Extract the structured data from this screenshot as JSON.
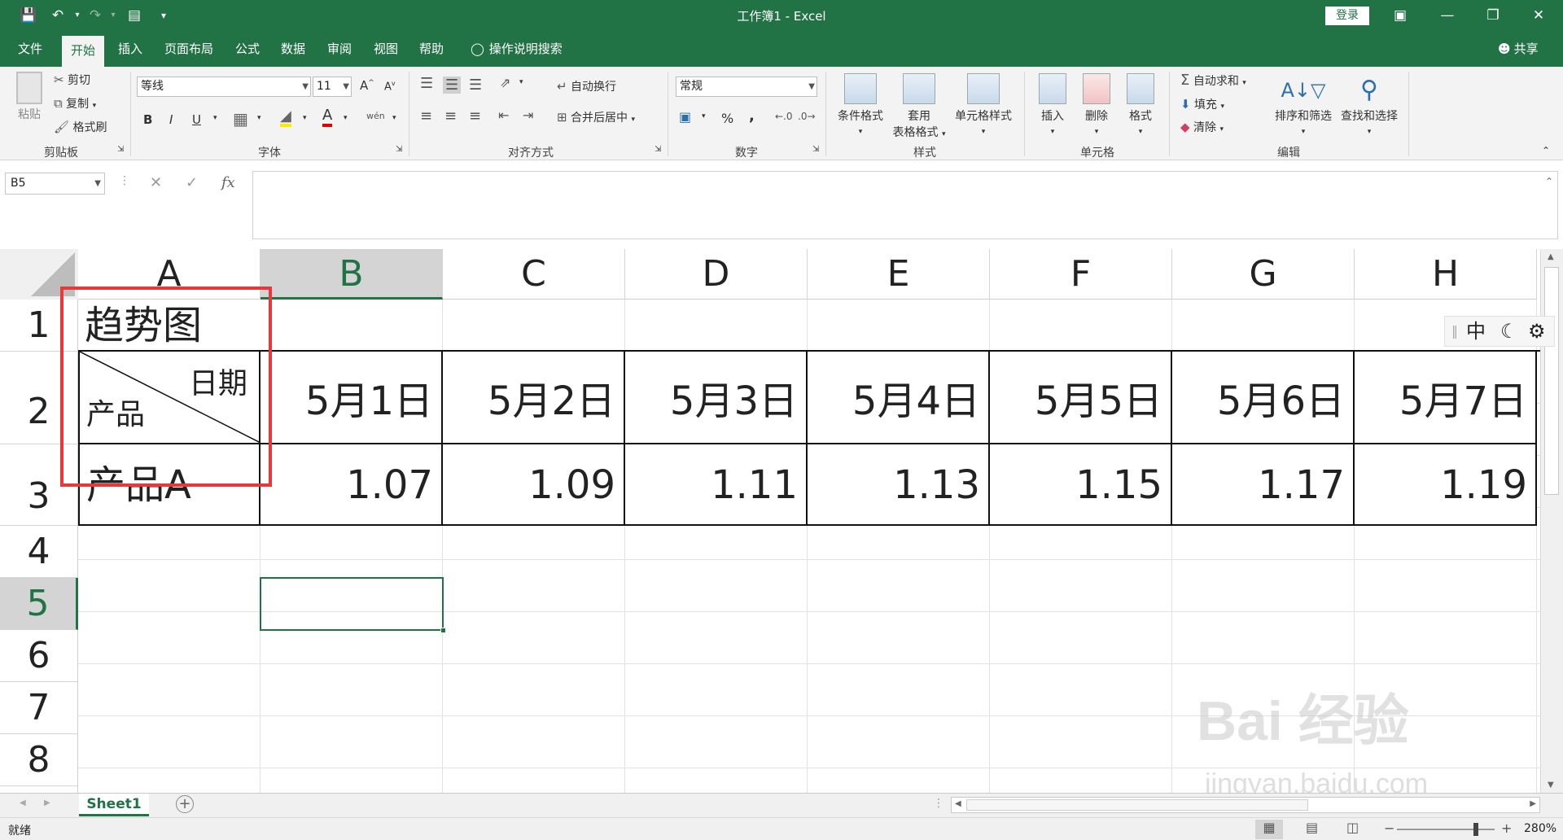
{
  "titlebar": {
    "title": "工作簿1  -  Excel",
    "login": "登录",
    "quick_access": [
      "save-icon",
      "undo-icon",
      "redo-icon",
      "print-preview-icon",
      "customize-icon"
    ]
  },
  "tabs": [
    "文件",
    "开始",
    "插入",
    "页面布局",
    "公式",
    "数据",
    "审阅",
    "视图",
    "帮助"
  ],
  "active_tab": "开始",
  "tell_me": "操作说明搜索",
  "share": "共享",
  "ribbon": {
    "clipboard": {
      "label": "剪贴板",
      "paste": "粘贴",
      "cut": "剪切",
      "copy": "复制",
      "format_painter": "格式刷"
    },
    "font": {
      "label": "字体",
      "font_name": "等线",
      "font_size": "11",
      "bold": "B",
      "italic": "I",
      "underline": "U",
      "grow": "A",
      "shrink": "A",
      "wen": "wén"
    },
    "alignment": {
      "label": "对齐方式",
      "wrap": "自动换行",
      "merge": "合并后居中"
    },
    "number": {
      "label": "数字",
      "format": "常规",
      "percent": "%",
      "comma": ","
    },
    "styles": {
      "label": "样式",
      "conditional": "条件格式",
      "table_line1": "套用",
      "table_line2": "表格格式",
      "cell_styles": "单元格样式"
    },
    "cells": {
      "label": "单元格",
      "insert": "插入",
      "delete": "删除",
      "format": "格式"
    },
    "editing": {
      "label": "编辑",
      "autosum": "自动求和",
      "fill": "填充",
      "clear": "清除",
      "sort": "排序和筛选",
      "find": "查找和选择"
    }
  },
  "formula_bar": {
    "name_box": "B5",
    "fx": "fx",
    "value": ""
  },
  "columns": [
    "A",
    "B",
    "C",
    "D",
    "E",
    "F",
    "G",
    "H"
  ],
  "selected_column": "B",
  "rows": [
    "1",
    "2",
    "3",
    "4",
    "5",
    "6",
    "7",
    "8"
  ],
  "selected_row": "5",
  "cells": {
    "A1": "趋势图",
    "A2_top": "日期",
    "A2_bottom": "产品",
    "dates": [
      "5月1日",
      "5月2日",
      "5月3日",
      "5月4日",
      "5月5日",
      "5月6日",
      "5月7日"
    ],
    "A3": "产品A",
    "values": [
      "1.07",
      "1.09",
      "1.11",
      "1.13",
      "1.15",
      "1.17",
      "1.19"
    ]
  },
  "ime": {
    "mode": "中"
  },
  "sheet_tab": "Sheet1",
  "status": {
    "ready": "就绪",
    "zoom": "280%"
  },
  "watermark": {
    "brand": "Bai  经验",
    "site": "jingyan.baidu.com"
  },
  "colors": {
    "excel_green": "#217346",
    "annotation_red": "#e8383c"
  }
}
